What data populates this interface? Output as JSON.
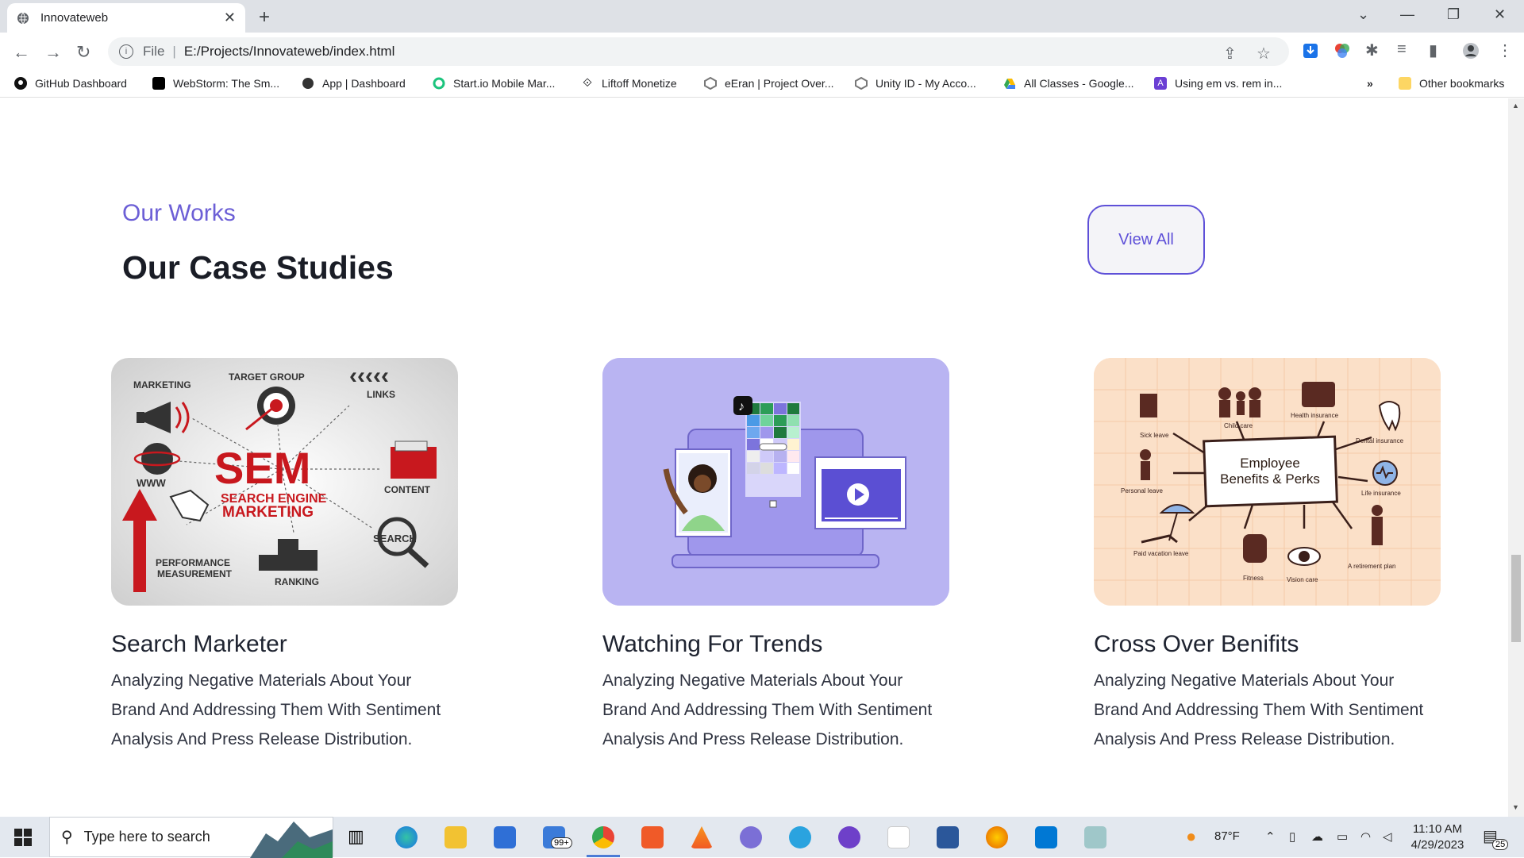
{
  "browser": {
    "tab_title": "Innovateweb",
    "scheme_label": "File",
    "url": "E:/Projects/Innovateweb/index.html",
    "bookmarks": [
      "GitHub Dashboard",
      "WebStorm: The Sm...",
      "App | Dashboard",
      "Start.io Mobile Mar...",
      "Liftoff Monetize",
      "eEran | Project Over...",
      "Unity ID - My Acco...",
      "All Classes - Google...",
      "Using em vs. rem in..."
    ],
    "bookmarks_overflow": "»",
    "other_bookmarks": "Other bookmarks"
  },
  "section": {
    "eyebrow": "Our Works",
    "heading": "Our Case Studies",
    "view_all_label": "View All"
  },
  "cards": [
    {
      "title": "Search Marketer",
      "description": "Analyzing Negative Materials About Your Brand And Addressing Them With Sentiment Analysis And Press Release Distribution.",
      "image_labels": {
        "marketing": "MARKETING",
        "target_group": "TARGET GROUP",
        "links": "LINKS",
        "www": "WWW",
        "sem": "SEM",
        "sem_sub1": "SEARCH ENGINE",
        "sem_sub2": "MARKETING",
        "content": "CONTENT",
        "search": "SEARCH",
        "performance1": "PERFORMANCE",
        "performance2": "MEASUREMENT",
        "ranking": "RANKING"
      }
    },
    {
      "title": "Watching For Trends",
      "description": "Analyzing Negative Materials About Your Brand And Addressing Them With Sentiment Analysis And Press Release Distribution."
    },
    {
      "title": "Cross Over Benifits",
      "description": "Analyzing Negative Materials About Your Brand And Addressing Them With Sentiment Analysis And Press Release Distribution.",
      "image_labels": {
        "center1": "Employee",
        "center2": "Benefits & Perks",
        "sick_leave": "Sick leave",
        "child_care": "Child care",
        "health_insurance": "Health insurance",
        "dental_insurance": "Dental insurance",
        "personal_leave": "Personal leave",
        "life_insurance": "Life insurance",
        "paid_vacation": "Paid vacation leave",
        "fitness": "Fitness",
        "vision_care": "Vision care",
        "retirement": "A retirement plan"
      }
    }
  ],
  "taskbar": {
    "search_placeholder": "Type here to search",
    "mail_badge": "99+",
    "weather": "87°F",
    "time": "11:10 AM",
    "date": "4/29/2023",
    "notification_count": "25"
  },
  "colors": {
    "accent": "#5e50d8",
    "eyebrow": "#6c5fd6",
    "card2_bg": "#b9b4f2",
    "card3_bg": "#fbe0c8"
  }
}
